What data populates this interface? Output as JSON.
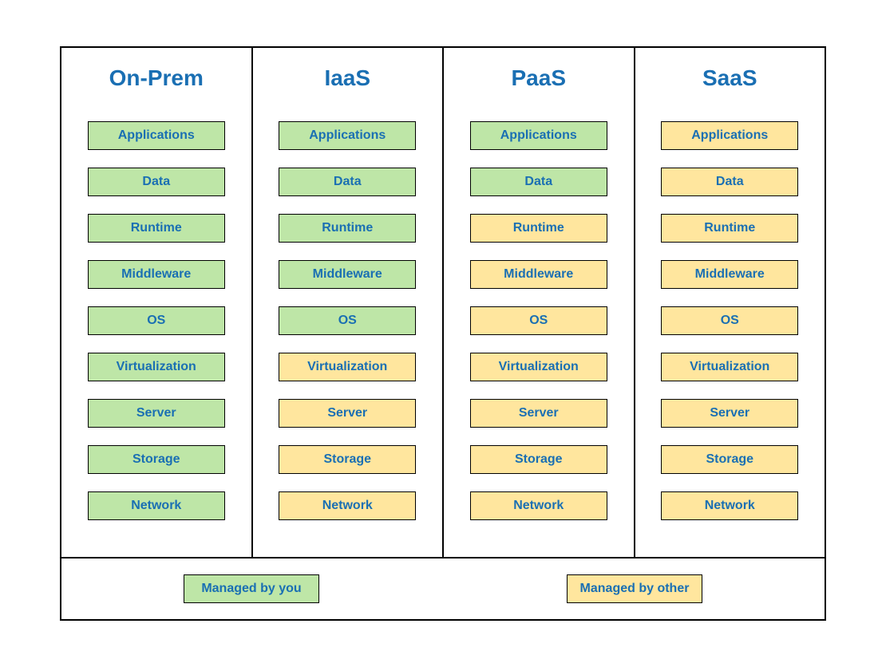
{
  "columns": [
    {
      "title": "On-Prem",
      "managed_you_count": 9
    },
    {
      "title": "IaaS",
      "managed_you_count": 5
    },
    {
      "title": "PaaS",
      "managed_you_count": 2
    },
    {
      "title": "SaaS",
      "managed_you_count": 0
    }
  ],
  "layers": [
    "Applications",
    "Data",
    "Runtime",
    "Middleware",
    "OS",
    "Virtualization",
    "Server",
    "Storage",
    "Network"
  ],
  "legend": {
    "you": "Managed by you",
    "other": "Managed by other"
  },
  "colors": {
    "managed_by_you": "#bee6a7",
    "managed_by_other": "#ffe69e",
    "text": "#1a6fb3",
    "border": "#000000"
  },
  "chart_data": {
    "type": "table",
    "title": "Cloud service model responsibility matrix",
    "columns": [
      "On-Prem",
      "IaaS",
      "PaaS",
      "SaaS"
    ],
    "rows": [
      "Applications",
      "Data",
      "Runtime",
      "Middleware",
      "OS",
      "Virtualization",
      "Server",
      "Storage",
      "Network"
    ],
    "values_legend": {
      "you": "Managed by you",
      "other": "Managed by other"
    },
    "values": [
      [
        "you",
        "you",
        "you",
        "other"
      ],
      [
        "you",
        "you",
        "you",
        "other"
      ],
      [
        "you",
        "you",
        "other",
        "other"
      ],
      [
        "you",
        "you",
        "other",
        "other"
      ],
      [
        "you",
        "you",
        "other",
        "other"
      ],
      [
        "you",
        "other",
        "other",
        "other"
      ],
      [
        "you",
        "other",
        "other",
        "other"
      ],
      [
        "you",
        "other",
        "other",
        "other"
      ],
      [
        "you",
        "other",
        "other",
        "other"
      ]
    ]
  }
}
